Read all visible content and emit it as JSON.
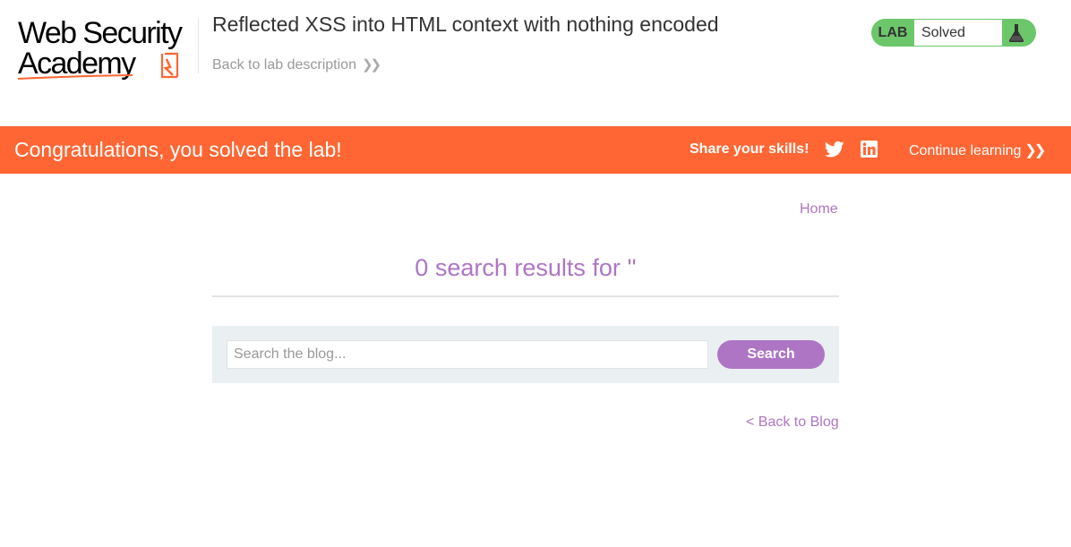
{
  "header": {
    "logo_line1": "Web Security",
    "logo_line2": "Academy",
    "lab_title": "Reflected XSS into HTML context with nothing encoded",
    "back_link": "Back to lab description",
    "back_link_icon": "double-chevron-right-icon",
    "lab_status": {
      "label": "LAB",
      "state": "Solved",
      "icon": "flask-icon",
      "color": "#6cc76b"
    }
  },
  "banner": {
    "message": "Congratulations, you solved the lab!",
    "share_text": "Share your skills!",
    "social_icons": [
      "twitter-icon",
      "linkedin-icon"
    ],
    "continue_link": "Continue learning",
    "color": "#ff6633"
  },
  "nav": {
    "home": "Home"
  },
  "main": {
    "results_heading": "0 search results for ''",
    "search": {
      "placeholder": "Search the blog...",
      "value": "",
      "button_label": "Search"
    },
    "back_to_blog": "< Back to Blog"
  },
  "colors": {
    "accent": "#ae75c5",
    "search_panel": "#eaeff2"
  }
}
